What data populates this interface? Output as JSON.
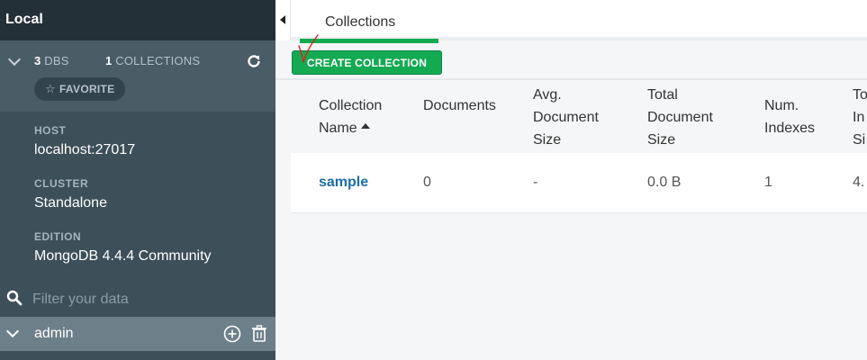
{
  "sidebar": {
    "title": "Local",
    "stats": {
      "dbs_count": "3",
      "dbs_label": "DBS",
      "collections_count": "1",
      "collections_label": "COLLECTIONS"
    },
    "favorite_label": "FAVORITE",
    "host": {
      "label": "HOST",
      "value": "localhost:27017"
    },
    "cluster": {
      "label": "CLUSTER",
      "value": "Standalone"
    },
    "edition": {
      "label": "EDITION",
      "value": "MongoDB 4.4.4 Community"
    },
    "filter_placeholder": "Filter your data",
    "databases": [
      {
        "name": "admin"
      }
    ]
  },
  "main": {
    "tabs": [
      {
        "label": "Collections",
        "active": true
      }
    ],
    "create_button": "CREATE COLLECTION",
    "table": {
      "headers": [
        {
          "line1": "Collection",
          "line2": "Name",
          "line3": ""
        },
        {
          "line1": "Documents",
          "line2": "",
          "line3": ""
        },
        {
          "line1": "Avg.",
          "line2": "Document",
          "line3": "Size"
        },
        {
          "line1": "Total",
          "line2": "Document",
          "line3": "Size"
        },
        {
          "line1": "Num.",
          "line2": "Indexes",
          "line3": ""
        },
        {
          "line1": "To",
          "line2": "In",
          "line3": "Si"
        }
      ],
      "rows": [
        {
          "name": "sample",
          "documents": "0",
          "avg_size": "-",
          "total_size": "0.0 B",
          "num_indexes": "1",
          "total_index_size": "4."
        }
      ]
    }
  },
  "colors": {
    "accent_green": "#13aa52",
    "sidebar_bg": "#3d4f58",
    "link_blue": "#1a6ea8",
    "annotation_red": "#e0201b"
  },
  "icons": [
    "chevron-down-icon",
    "refresh-icon",
    "star-icon",
    "search-icon",
    "add-circle-icon",
    "trash-icon",
    "collapse-left-icon",
    "sort-ascending-icon",
    "checkmark-annotation-icon"
  ]
}
